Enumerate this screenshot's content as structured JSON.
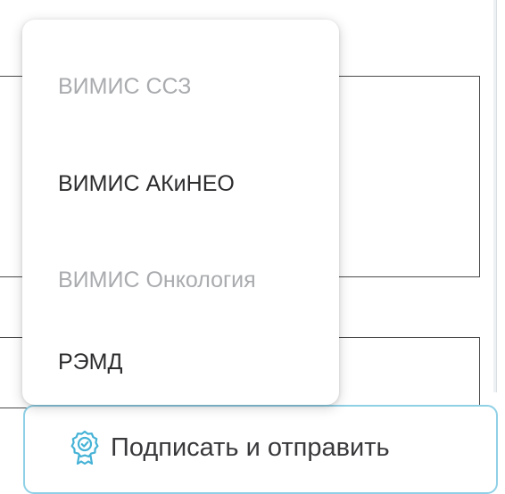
{
  "menu": {
    "items": [
      {
        "label": "ВИМИС ССЗ",
        "state": "disabled"
      },
      {
        "label": "ВИМИС АКиНЕО",
        "state": "enabled"
      },
      {
        "label": "ВИМИС Онкология",
        "state": "disabled"
      },
      {
        "label": "РЭМД",
        "state": "enabled"
      }
    ]
  },
  "sign_button": {
    "label": "Подписать и отправить",
    "icon": "certificate-icon"
  },
  "colors": {
    "disabled_text": "#a9abae",
    "enabled_text": "#2c2c2e",
    "button_border": "#8fd0e6",
    "icon_color": "#45b2d6"
  }
}
